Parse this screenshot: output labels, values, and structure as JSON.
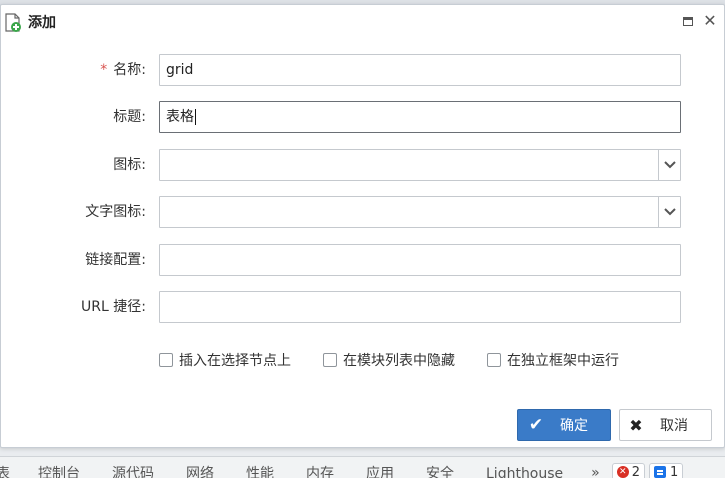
{
  "dialog": {
    "title": "添加",
    "fields": [
      {
        "label": "名称:",
        "required_mark": "*",
        "value": "grid",
        "type": "text"
      },
      {
        "label": "标题:",
        "value": "表格",
        "type": "text"
      },
      {
        "label": "图标:",
        "value": "",
        "type": "select"
      },
      {
        "label": "文字图标:",
        "value": "",
        "type": "select"
      },
      {
        "label": "链接配置:",
        "value": "",
        "type": "text"
      },
      {
        "label": "URL 捷径:",
        "value": "",
        "type": "text"
      }
    ],
    "checkboxes": [
      {
        "label": "插入在选择节点上",
        "checked": false
      },
      {
        "label": "在模块列表中隐藏",
        "checked": false
      },
      {
        "label": "在独立框架中运行",
        "checked": false
      }
    ],
    "buttons": {
      "ok": "确定",
      "cancel": "取消"
    }
  },
  "devtools": {
    "tabs": [
      "表",
      "控制台",
      "源代码",
      "网络",
      "性能",
      "内存",
      "应用",
      "安全",
      "Lighthouse"
    ],
    "more": "»",
    "error_count": "2",
    "message_count": "1"
  },
  "colors": {
    "primary_button": "#3a7bc8",
    "required": "#d9534f"
  }
}
